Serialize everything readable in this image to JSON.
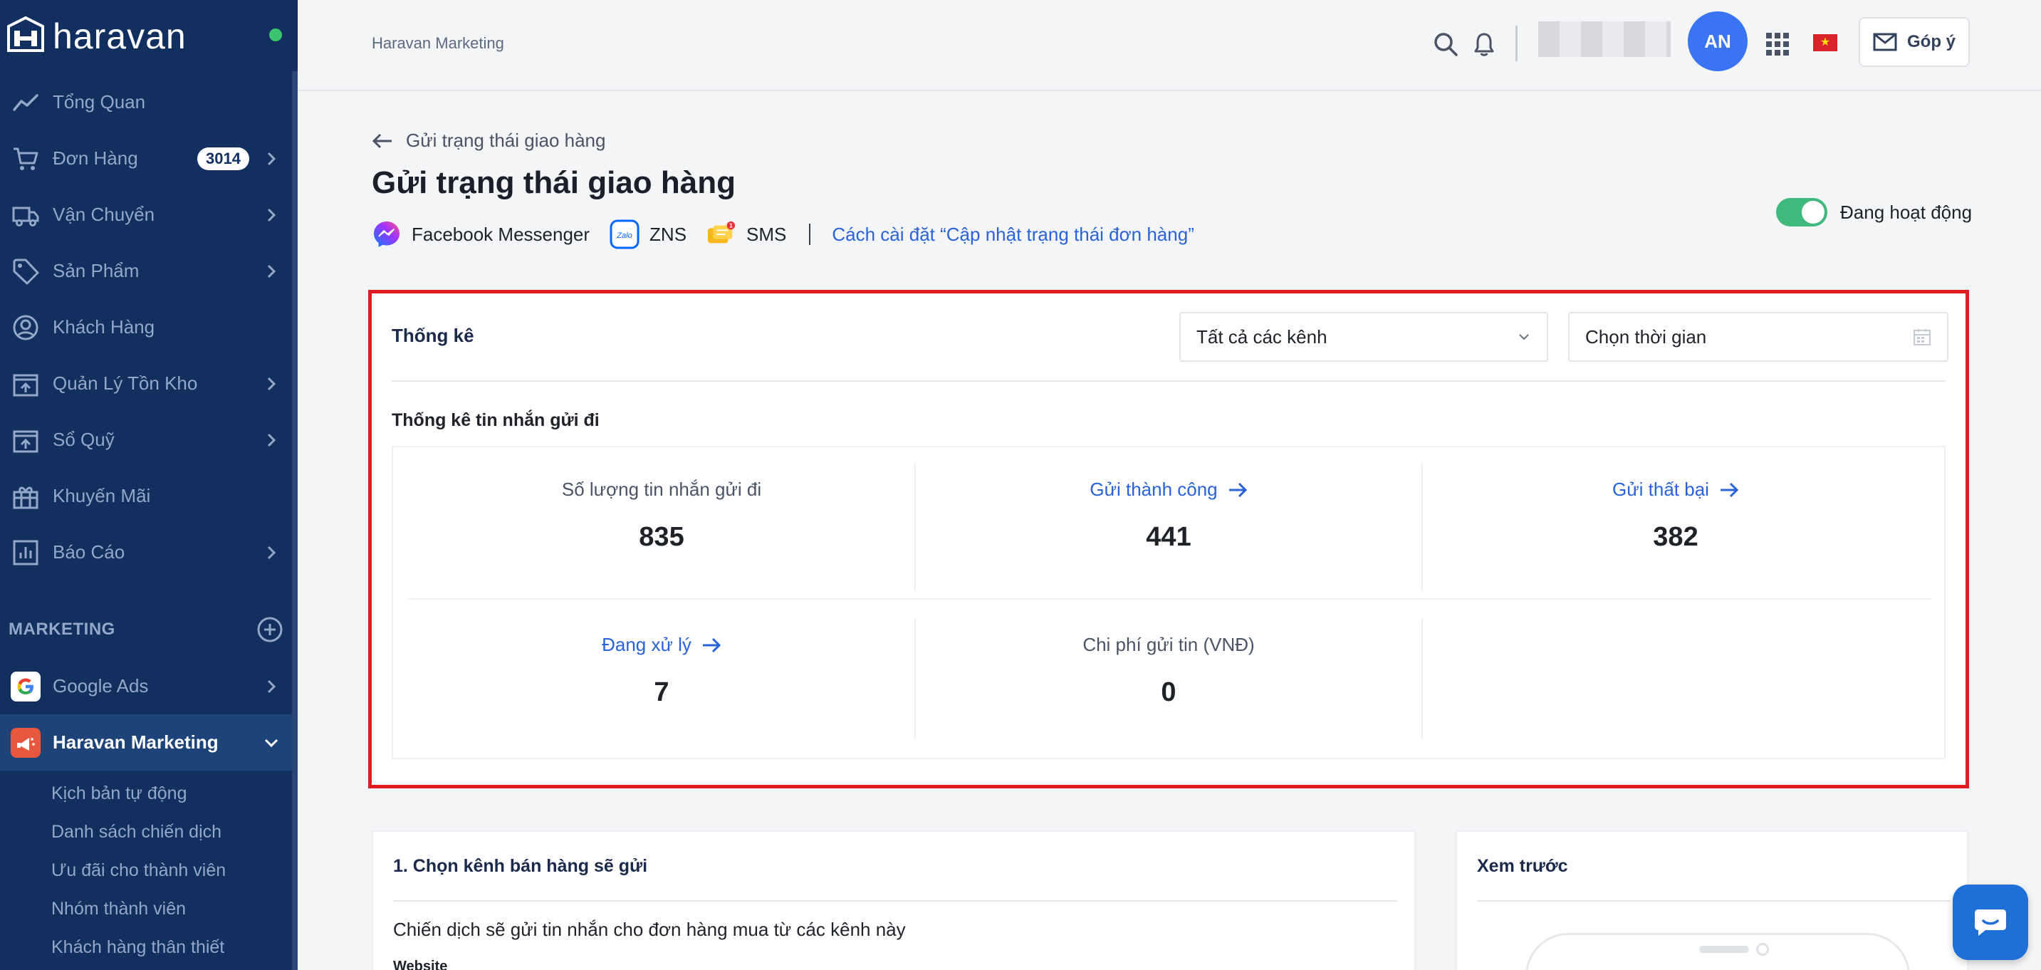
{
  "sidebar": {
    "logo_text": "haravan",
    "nav": [
      {
        "label": "Tổng Quan",
        "icon": "trend-icon",
        "chevron": false
      },
      {
        "label": "Đơn Hàng",
        "icon": "cart-icon",
        "chevron": true,
        "badge": "3014"
      },
      {
        "label": "Vận Chuyển",
        "icon": "truck-icon",
        "chevron": true
      },
      {
        "label": "Sản Phẩm",
        "icon": "tag-icon",
        "chevron": true
      },
      {
        "label": "Khách Hàng",
        "icon": "user-icon",
        "chevron": false
      },
      {
        "label": "Quản Lý Tồn Kho",
        "icon": "inventory-icon",
        "chevron": true
      },
      {
        "label": "Sổ Quỹ",
        "icon": "cashbook-icon",
        "chevron": true
      },
      {
        "label": "Khuyến Mãi",
        "icon": "gift-icon",
        "chevron": false
      },
      {
        "label": "Báo Cáo",
        "icon": "report-icon",
        "chevron": true
      }
    ],
    "marketing_section": "MARKETING",
    "apps": [
      {
        "label": "Google Ads",
        "icon": "google-icon"
      },
      {
        "label": "Haravan Marketing",
        "icon": "haravan-marketing-icon"
      }
    ],
    "sub_items": [
      "Kịch bản tự động",
      "Danh sách chiến dịch",
      "Ưu đãi cho thành viên",
      "Nhóm thành viên",
      "Khách hàng thân thiết"
    ]
  },
  "header": {
    "breadcrumb": "Haravan Marketing",
    "avatar_initials": "AN",
    "feedback_label": "Góp ý",
    "flag_icon": "vietnam-flag-icon"
  },
  "page": {
    "back_label": "Gửi trạng thái giao hàng",
    "title": "Gửi trạng thái giao hàng",
    "channels": [
      {
        "label": "Facebook Messenger",
        "icon": "messenger-icon"
      },
      {
        "label": "ZNS",
        "icon": "zalo-icon"
      },
      {
        "label": "SMS",
        "icon": "sms-icon"
      }
    ],
    "setup_link": "Cách cài đặt “Cập nhật trạng thái đơn hàng”",
    "status_label": "Đang hoạt động"
  },
  "stats": {
    "title": "Thống kê",
    "channel_select": "Tất cả các kênh",
    "time_select": "Chọn thời gian",
    "subtitle": "Thống kê tin nhắn gửi đi",
    "cells": [
      {
        "label": "Số lượng tin nhắn gửi đi",
        "value": "835"
      },
      {
        "label": "Gửi thành công",
        "value": "441"
      },
      {
        "label": "Gửi thất bại",
        "value": "382"
      },
      {
        "label": "Đang xử lý",
        "value": "7"
      },
      {
        "label": "Chi phí gửi tin (VNĐ)",
        "value": "0"
      }
    ]
  },
  "channel_card": {
    "title": "1. Chọn kênh bán hàng sẽ gửi",
    "description": "Chiến dịch sẽ gửi tin nhắn cho đơn hàng mua từ các kênh này",
    "first_option": "Website"
  },
  "preview_card": {
    "title": "Xem trước"
  },
  "colors": {
    "sidebar_bg": "#12305f",
    "accent_blue": "#2962d9",
    "highlight_red": "#e01b22",
    "toggle_green": "#3fb97c"
  }
}
